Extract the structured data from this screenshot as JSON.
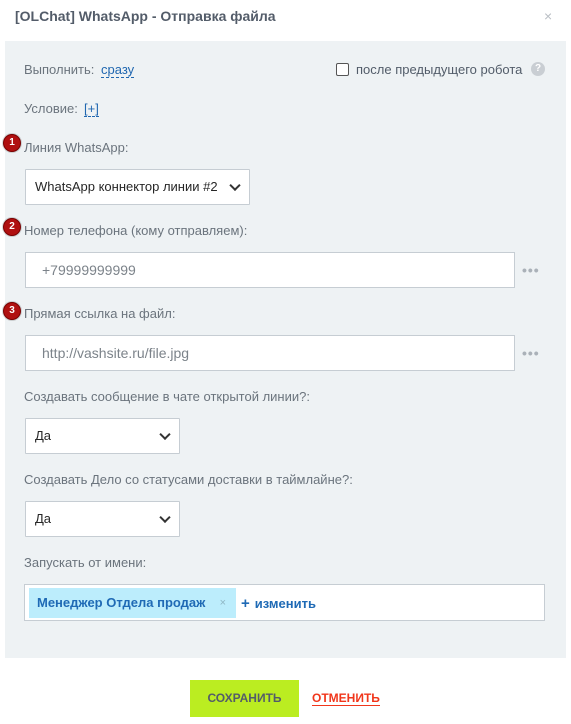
{
  "dialog": {
    "title": "[OLChat] WhatsApp - Отправка файла",
    "close_icon": "close-icon"
  },
  "execute": {
    "label": "Выполнить:",
    "value": "сразу"
  },
  "after_previous": {
    "label": "после предыдущего робота",
    "checked": false,
    "help": "?"
  },
  "condition": {
    "label": "Условие:",
    "value": "[+]"
  },
  "markers": [
    "1",
    "2",
    "3"
  ],
  "whatsapp_line": {
    "label": "Линия WhatsApp:",
    "selected": "WhatsApp коннектор линии #2"
  },
  "phone": {
    "label": "Номер телефона (кому отправляем):",
    "value": "+79999999999",
    "more": "•••"
  },
  "file_link": {
    "label": "Прямая ссылка на файл:",
    "value": "http://vashsite.ru/file.jpg",
    "more": "•••"
  },
  "create_message": {
    "label": "Создавать сообщение в чате открытой линии?:",
    "selected": "Да"
  },
  "create_task": {
    "label": "Создавать Дело со статусами доставки в таймлайне?:",
    "selected": "Да"
  },
  "run_as": {
    "label": "Запускать от имени:",
    "user": "Менеджер Отдела продаж",
    "remove": "×",
    "change_plus": "+",
    "change": "изменить"
  },
  "footer": {
    "save": "СОХРАНИТЬ",
    "cancel": "ОТМЕНИТЬ"
  },
  "colors": {
    "accent_green": "#bbed21",
    "cancel_red": "#f1361b",
    "link_blue": "#2067b0",
    "marker_red": "#b01010",
    "panel_bg": "#eef2f4"
  }
}
